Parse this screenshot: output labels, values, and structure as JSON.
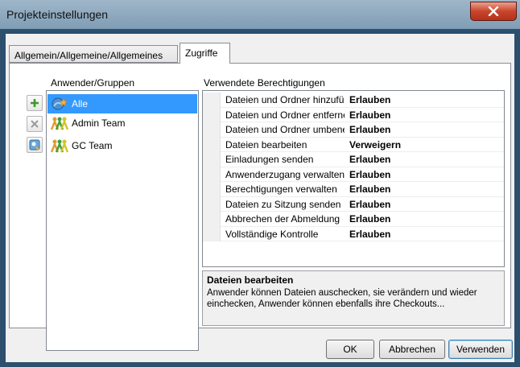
{
  "window": {
    "title": "Projekteinstellungen"
  },
  "tabs": [
    {
      "label": "Allgemein/Allgemeine/Allgemeines",
      "active": false
    },
    {
      "label": "Zugriffe",
      "active": true
    }
  ],
  "users": {
    "header": "Anwender/Gruppen",
    "items": [
      {
        "label": "Alle",
        "icon": "user-group-star-icon",
        "selected": true
      },
      {
        "label": "Admin Team",
        "icon": "team-icon",
        "selected": false
      },
      {
        "label": "GC Team",
        "icon": "team-icon",
        "selected": false
      }
    ],
    "buttons": [
      {
        "icon": "add-icon",
        "enabled": true
      },
      {
        "icon": "remove-icon",
        "enabled": false
      },
      {
        "icon": "edit-users-icon",
        "enabled": true
      }
    ]
  },
  "permissions": {
    "header": "Verwendete Berechtigungen",
    "rows": [
      {
        "name": "Dateien und Ordner hinzufügen",
        "value": "Erlauben"
      },
      {
        "name": "Dateien und Ordner entfernen",
        "value": "Erlauben"
      },
      {
        "name": "Dateien und Ordner umbenennen",
        "value": "Erlauben"
      },
      {
        "name": "Dateien bearbeiten",
        "value": "Verweigern"
      },
      {
        "name": "Einladungen senden",
        "value": "Erlauben"
      },
      {
        "name": "Anwenderzugang verwalten",
        "value": "Erlauben"
      },
      {
        "name": "Berechtigungen verwalten",
        "value": "Erlauben"
      },
      {
        "name": "Dateien zu Sitzung senden",
        "value": "Erlauben"
      },
      {
        "name": "Abbrechen der Abmeldung",
        "value": "Erlauben"
      },
      {
        "name": "Vollständige Kontrolle",
        "value": "Erlauben"
      }
    ]
  },
  "description": {
    "title": "Dateien bearbeiten",
    "text": "Anwender können Dateien auschecken, sie verändern und wieder einchecken, Anwender können ebenfalls ihre Checkouts..."
  },
  "buttons": {
    "ok": "OK",
    "cancel": "Abbrechen",
    "apply": "Verwenden"
  },
  "colors": {
    "selection": "#3399ff",
    "title_bar": "#8ea9bf",
    "close_button": "#c9452c"
  }
}
